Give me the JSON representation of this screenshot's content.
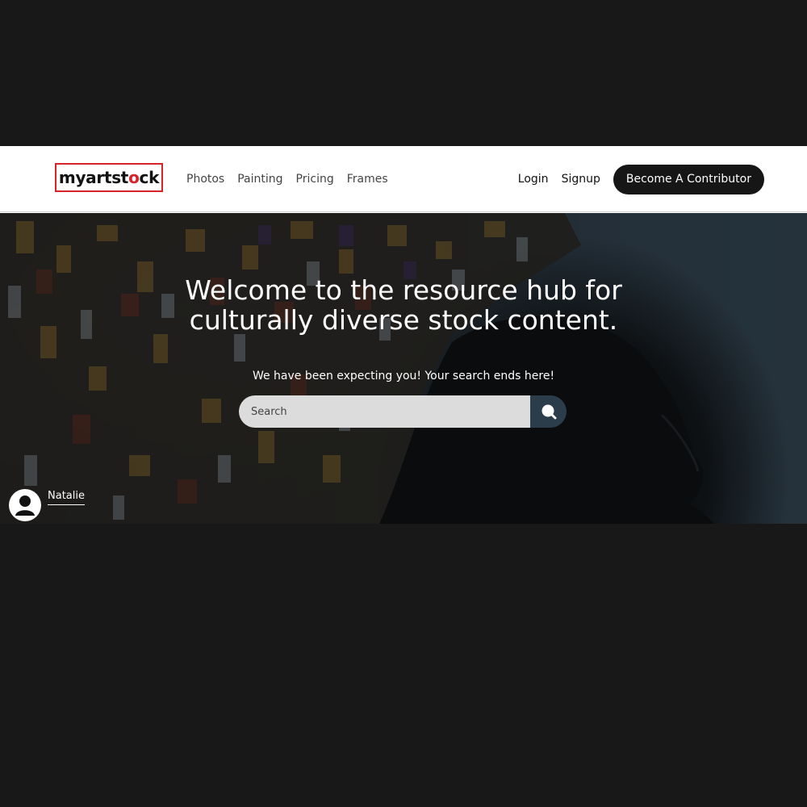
{
  "brand": {
    "logo_text_start": "myartst",
    "logo_text_mid": "o",
    "logo_text_end": "ck",
    "logo_color": "#d8232a"
  },
  "nav": {
    "links": [
      "Photos",
      "Painting",
      "Pricing",
      "Frames"
    ],
    "login": "Login",
    "signup": "Signup",
    "contributor_button": "Become A Contributor"
  },
  "hero": {
    "title": "Welcome to the resource hub for culturally diverse stock content.",
    "subtitle": "We have been expecting you! Your search ends here!",
    "search_placeholder": "Search",
    "search_icon": "search-icon",
    "photo_credit_name": "Natalie"
  },
  "colors": {
    "page_background": "#181818",
    "button_dark": "#161616",
    "search_button": "#2b3d4b"
  }
}
